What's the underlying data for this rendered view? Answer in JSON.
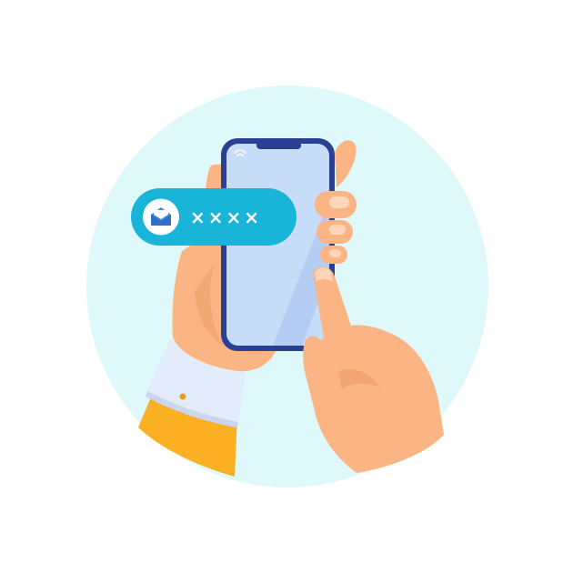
{
  "notification": {
    "icon": "envelope-open-icon",
    "code_text": "××××"
  },
  "colors": {
    "background_circle": "#dff8fa",
    "notification_pill": "#19b5d8",
    "phone_frame": "#2a4095",
    "phone_screen": "#c7dcf7",
    "skin": "#fbb584",
    "skin_shadow": "#ec9a68",
    "cuff": "#e3ecfa",
    "sleeve": "#fbb024",
    "icon_blue": "#3d86e0"
  }
}
